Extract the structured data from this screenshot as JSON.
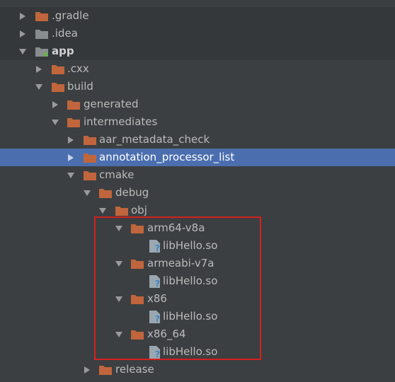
{
  "colors": {
    "background": "#3c3f41",
    "selection": "#4b6eaf",
    "folder": "#c0653c",
    "highlight_box": "#d42020"
  },
  "tree": {
    "gradle": {
      "label": ".gradle",
      "state": "collapsed"
    },
    "idea": {
      "label": ".idea",
      "state": "collapsed"
    },
    "app": {
      "label": "app",
      "state": "expanded",
      "icon": "module-folder-icon"
    },
    "cxx": {
      "label": ".cxx",
      "state": "collapsed"
    },
    "build": {
      "label": "build",
      "state": "expanded"
    },
    "generated": {
      "label": "generated",
      "state": "collapsed"
    },
    "intermediates": {
      "label": "intermediates",
      "state": "expanded"
    },
    "aar_metadata_check": {
      "label": "aar_metadata_check",
      "state": "collapsed"
    },
    "annotation_processor_list": {
      "label": "annotation_processor_list",
      "state": "collapsed",
      "selected": true
    },
    "cmake": {
      "label": "cmake",
      "state": "expanded"
    },
    "debug": {
      "label": "debug",
      "state": "expanded"
    },
    "obj": {
      "label": "obj",
      "state": "expanded"
    },
    "arm64": {
      "label": "arm64-v8a",
      "state": "expanded",
      "file": "libHello.so"
    },
    "armeabi": {
      "label": "armeabi-v7a",
      "state": "expanded",
      "file": "libHello.so"
    },
    "x86": {
      "label": "x86",
      "state": "expanded",
      "file": "libHello.so"
    },
    "x86_64": {
      "label": "x86_64",
      "state": "expanded",
      "file": "libHello.so"
    },
    "release": {
      "label": "release",
      "state": "collapsed"
    }
  }
}
